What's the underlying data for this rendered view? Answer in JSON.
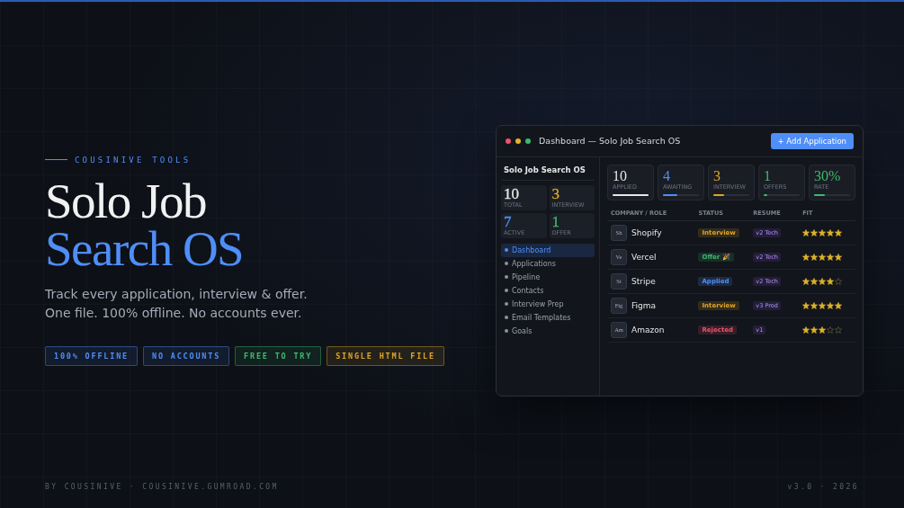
{
  "brand": "COUSINIVE TOOLS",
  "title_line_1": "Solo Job",
  "title_line_2": "Search OS",
  "description": [
    "Track every application, interview & offer.",
    "One file. 100% offline. No accounts ever."
  ],
  "tags": [
    {
      "label": "100% OFFLINE",
      "color": "#4f8ef7"
    },
    {
      "label": "NO ACCOUNTS",
      "color": "#4f8ef7"
    },
    {
      "label": "FREE TO TRY",
      "color": "#3fb96f"
    },
    {
      "label": "SINGLE HTML FILE",
      "color": "#e0a526"
    }
  ],
  "window": {
    "title": "Dashboard — Solo Job Search OS",
    "add_button": "+ Add Application",
    "sidebar": {
      "title": "Solo Job Search OS",
      "stats": [
        {
          "value": "10",
          "label": "TOTAL",
          "color": "#e6e6e6"
        },
        {
          "value": "3",
          "label": "INTERVIEW",
          "color": "#e0a526"
        },
        {
          "value": "7",
          "label": "ACTIVE",
          "color": "#4f8ef7"
        },
        {
          "value": "1",
          "label": "OFFER",
          "color": "#3fb96f"
        }
      ],
      "items": [
        {
          "label": "Dashboard",
          "selected": true
        },
        {
          "label": "Applications",
          "selected": false
        },
        {
          "label": "Pipeline",
          "selected": false
        },
        {
          "label": "Contacts",
          "selected": false
        },
        {
          "label": "Interview Prep",
          "selected": false
        },
        {
          "label": "Email Templates",
          "selected": false
        },
        {
          "label": "Goals",
          "selected": false
        }
      ]
    },
    "stats": [
      {
        "value": "10",
        "label": "APPLIED",
        "color": "#e6e6e6",
        "level": 1.0
      },
      {
        "value": "4",
        "label": "AWAITING",
        "color": "#4f8ef7",
        "level": 0.4
      },
      {
        "value": "3",
        "label": "INTERVIEW",
        "color": "#e0a526",
        "level": 0.3
      },
      {
        "value": "1",
        "label": "OFFERS",
        "color": "#3fb96f",
        "level": 0.1
      },
      {
        "value": "30%",
        "label": "RATE",
        "color": "#3fb96f",
        "level": 0.3
      }
    ],
    "table": {
      "columns": [
        "COMPANY / ROLE",
        "STATUS",
        "RESUME",
        "FIT"
      ],
      "rows": [
        {
          "initials": "Sh",
          "company": "Shopify",
          "status": "Interview",
          "kind": "interview",
          "resume": "v2 Tech",
          "stars": 5
        },
        {
          "initials": "Ve",
          "company": "Vercel",
          "status": "Offer 🎉",
          "kind": "offer",
          "resume": "v2 Tech",
          "stars": 5
        },
        {
          "initials": "St",
          "company": "Stripe",
          "status": "Applied",
          "kind": "applied",
          "resume": "v2 Tech",
          "stars": 4
        },
        {
          "initials": "Fig",
          "company": "Figma",
          "status": "Interview",
          "kind": "interview",
          "resume": "v3 Prod",
          "stars": 5
        },
        {
          "initials": "Am",
          "company": "Amazon",
          "status": "Rejected",
          "kind": "rejected",
          "resume": "v1",
          "stars": 3
        }
      ]
    }
  },
  "footer_left": "BY COUSINIVE · COUSINIVE.GUMROAD.COM",
  "footer_right": "v3.0 · 2026"
}
